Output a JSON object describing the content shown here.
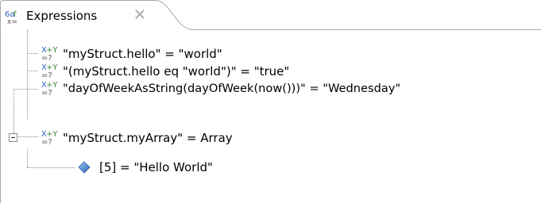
{
  "tab": {
    "label": "Expressions",
    "icon": "expressions-icon",
    "close_icon": "close-icon"
  },
  "expressions": [
    {
      "text": "\"myStruct.hello\" = \"world\"",
      "icon": "watch-expression-icon"
    },
    {
      "text": "\"(myStruct.hello eq \"world\")\" = \"true\"",
      "icon": "watch-expression-icon"
    },
    {
      "text": "\"dayOfWeekAsString(dayOfWeek(now()))\" = \"Wednesday\"",
      "icon": "watch-expression-icon"
    },
    {
      "text": "\"myStruct.myArray\" = Array",
      "icon": "watch-expression-icon",
      "expanded": true,
      "children": [
        {
          "text": "[5]  = \"Hello World\"",
          "icon": "variable-diamond-icon"
        }
      ]
    }
  ],
  "colors": {
    "border": "#a9a9a9",
    "icon_blue": "#2f5fbf",
    "icon_green": "#3a8a3a",
    "diamond": "#3a7fd0"
  }
}
